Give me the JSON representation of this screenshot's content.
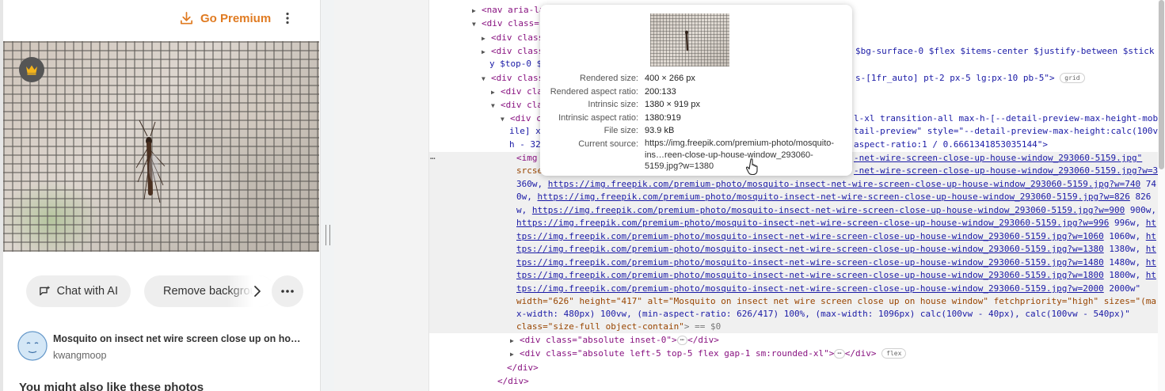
{
  "app": {
    "premium_label": "Go Premium",
    "chat_ai_label": "Chat with AI",
    "remove_bg_label": "Remove background",
    "photo_title": "Mosquito on insect net wire screen close up on house window",
    "author": "kwangmoop",
    "related_heading": "You might also like these photos",
    "accent_color": "#e07b22",
    "icons": [
      "download-icon",
      "kebab-icon",
      "crown-icon",
      "chat-ai-icon",
      "remove-bg-icon",
      "chevron-right-icon",
      "more-icon"
    ]
  },
  "tooltip": {
    "rows": [
      {
        "label": "Rendered size:",
        "value": "400 × 266 px"
      },
      {
        "label": "Rendered aspect ratio:",
        "value": "200:133"
      },
      {
        "label": "Intrinsic size:",
        "value": "1380 × 919 px"
      },
      {
        "label": "Intrinsic aspect ratio:",
        "value": "1380:919"
      },
      {
        "label": "File size:",
        "value": "93.9 kB"
      }
    ],
    "source_label": "Current source:",
    "source_value": "https://img.freepik.com/premium-photo/mosquito-ins…reen-close-up-house-window_293060-5159.jpg?w=1380"
  },
  "devtools": {
    "ellipsis": "…",
    "badges": {
      "grid": "grid",
      "flex": "flex",
      "dots": "⋯"
    },
    "lines": {
      "l0": "<nav aria-la",
      "l1a": "<div class=\"",
      "l2": "<div class",
      "l3": "<div class",
      "l3b": "$bg-surface-0 $flex $items-center $justify-between $stick",
      "l4": "y $top-0 $",
      "l5a": "<div class",
      "l5b": "s-[1fr_auto] pt-2 px-5 lg:px-10 pb-5\">",
      "l6": "<div cla",
      "l7": "<div cla",
      "l8a": "<div c",
      "l8b": "l-xl transition-all max-h-[--detail-preview-max-height-mob",
      "l9a": "ile] x",
      "l9b": "tail-preview\" style=\"--detail-preview-max-height:calc(100v",
      "l10a": "h - 32",
      "l10b": "aspect-ratio:1 / 0.6661341853035144\">",
      "img_tag": "<img",
      "img_src_tail": "-net-wire-screen-close-up-house-window_293060-5159.jpg\"",
      "srcset_attr": "srcse",
      "srcset_tail": "-net-wire-screen-close-up-house-window_293060-5159.jpg?w=360",
      "s1_pre": "360w, ",
      "s1_url": "https://img.freepik.com/premium-photo/mosquito-insect-net-wire-screen-close-up-house-window_293060-5159.jpg?w=740",
      "s1_post": " 74",
      "s2_pre": "0w, ",
      "s2_url": "https://img.freepik.com/premium-photo/mosquito-insect-net-wire-screen-close-up-house-window_293060-5159.jpg?w=826",
      "s2_post": " 826",
      "s3_pre": "w, ",
      "s3_url": "https://img.freepik.com/premium-photo/mosquito-insect-net-wire-screen-close-up-house-window_293060-5159.jpg?w=900",
      "s3_post": " 900w,",
      "s4_url": "https://img.freepik.com/premium-photo/mosquito-insect-net-wire-screen-close-up-house-window_293060-5159.jpg?w=996",
      "s4_post": " 996w, ",
      "s4_tail": "ht",
      "s5_head": "tps://img.freepik.com/premium-photo/mosquito-insect-net-wire-screen-close-up-house-window_293060-5159.jpg?w=1060",
      "s5_post": " 1060w, ",
      "s5_tail": "ht",
      "s6_head": "tps://img.freepik.com/premium-photo/mosquito-insect-net-wire-screen-close-up-house-window_293060-5159.jpg?w=1380",
      "s6_post": " 1380w, ",
      "s6_tail": "ht",
      "s7_head": "tps://img.freepik.com/premium-photo/mosquito-insect-net-wire-screen-close-up-house-window_293060-5159.jpg?w=1480",
      "s7_post": " 1480w, ",
      "s7_tail": "ht",
      "s8_head": "tps://img.freepik.com/premium-photo/mosquito-insect-net-wire-screen-close-up-house-window_293060-5159.jpg?w=1800",
      "s8_post": " 1800w, ",
      "s8_tail": "ht",
      "s9_head": "tps://img.freepik.com/premium-photo/mosquito-insect-net-wire-screen-close-up-house-window_293060-5159.jpg?w=2000",
      "s9_post": " 2000w\"",
      "w1_attrs": "width=\"626\" height=\"417\" alt=\"Mosquito on insect net wire screen close up on house window\" fetchpriority=\"high\" sizes=\"(ma",
      "w2": "x-width: 480px) 100vw, (min-aspect-ratio: 626/417) 100%, (max-width: 1096px) calc(100vw - 40px), calc(100vw - 540px)\"",
      "w3_attr": "class=\"size-full object-contain\"",
      "w3_post": "> == $0",
      "d1": "<div class=\"absolute inset-0\">",
      "d1_close": "</div>",
      "d2": "<div class=\"absolute left-5 top-5 flex gap-1 sm:rounded-xl\">",
      "d2_close": "</div>",
      "c1": "</div>",
      "c2": "</div>"
    }
  }
}
